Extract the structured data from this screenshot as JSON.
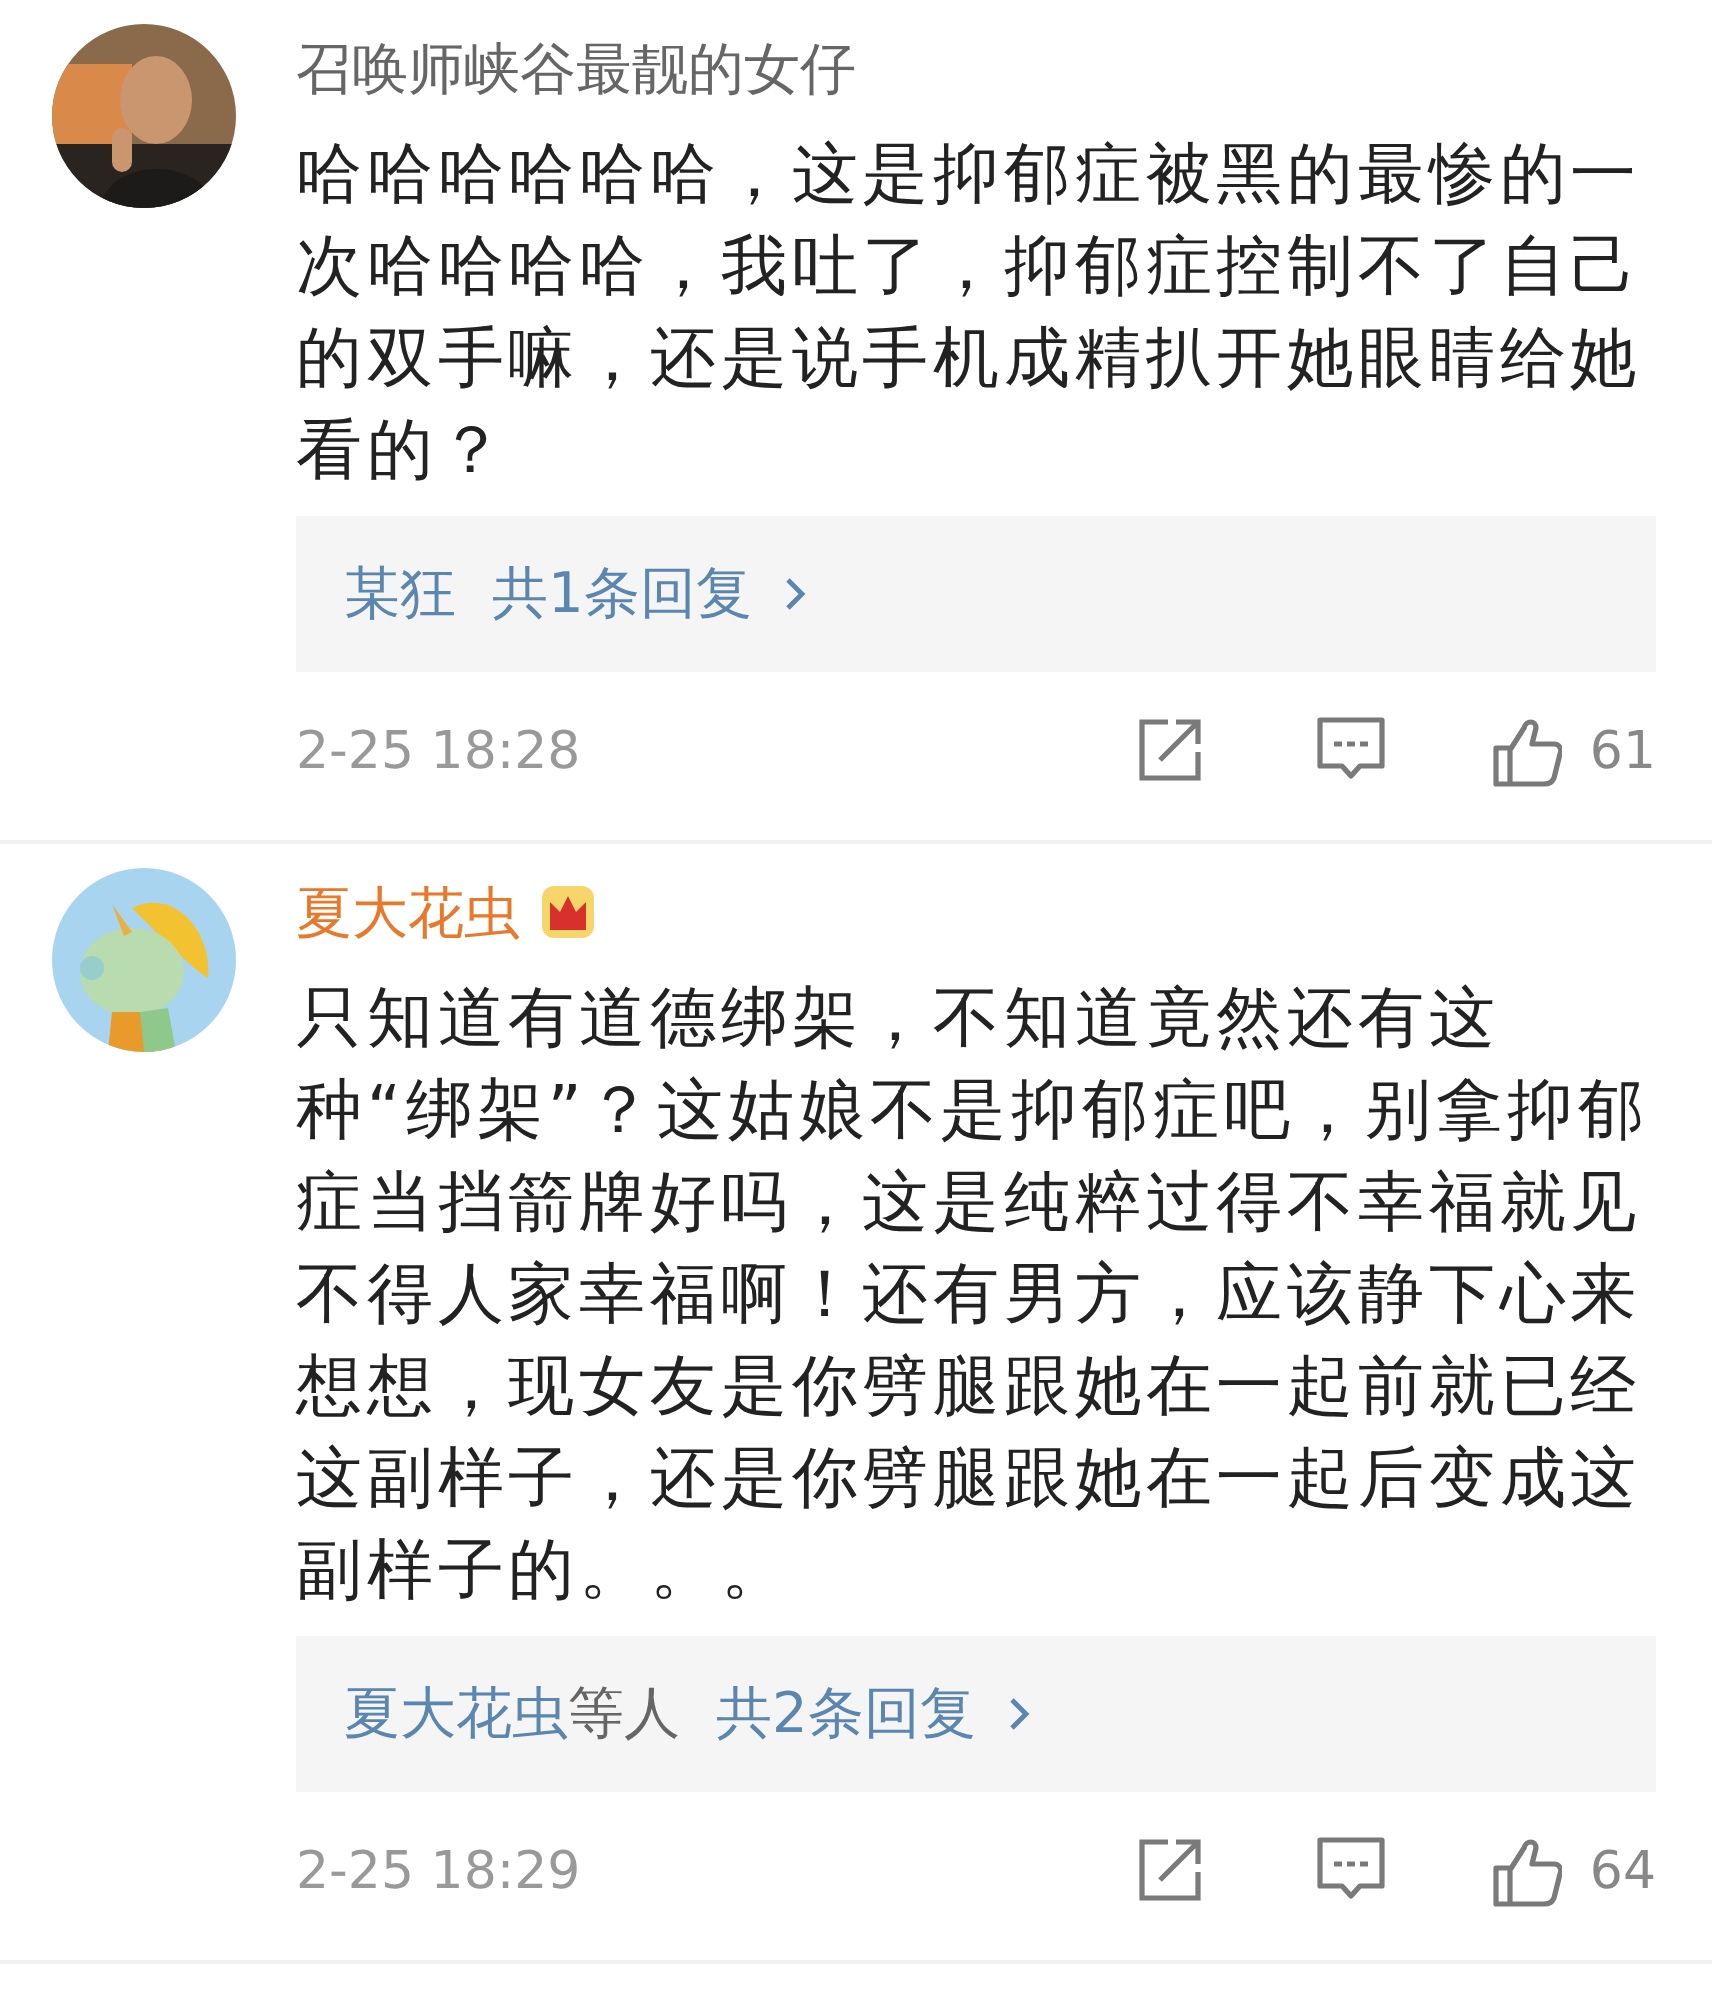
{
  "comments": [
    {
      "name": "召唤师峡谷最靓的女仔",
      "vip": false,
      "text": "哈哈哈哈哈哈，这是抑郁症被黑的最惨的一次哈哈哈哈，我吐了，抑郁症控制不了自己的双手嘛，还是说手机成精扒开她眼睛给她看的？",
      "replies": {
        "users": "某狂",
        "count": "共1条回复"
      },
      "time": "2-25 18:28",
      "likes": "61"
    },
    {
      "name": "夏大花虫",
      "vip": true,
      "text": "只知道有道德绑架，不知道竟然还有这种“绑架”？这姑娘不是抑郁症吧，别拿抑郁症当挡箭牌好吗，这是纯粹过得不幸福就见不得人家幸福啊！还有男方，应该静下心来想想，现女友是你劈腿跟她在一起前就已经这副样子，还是你劈腿跟她在一起后变成这副样子的。。。",
      "replies": {
        "users": "夏大花虫",
        "suffix": "等人",
        "count": "共2条回复"
      },
      "time": "2-25 18:29",
      "likes": "64"
    }
  ]
}
